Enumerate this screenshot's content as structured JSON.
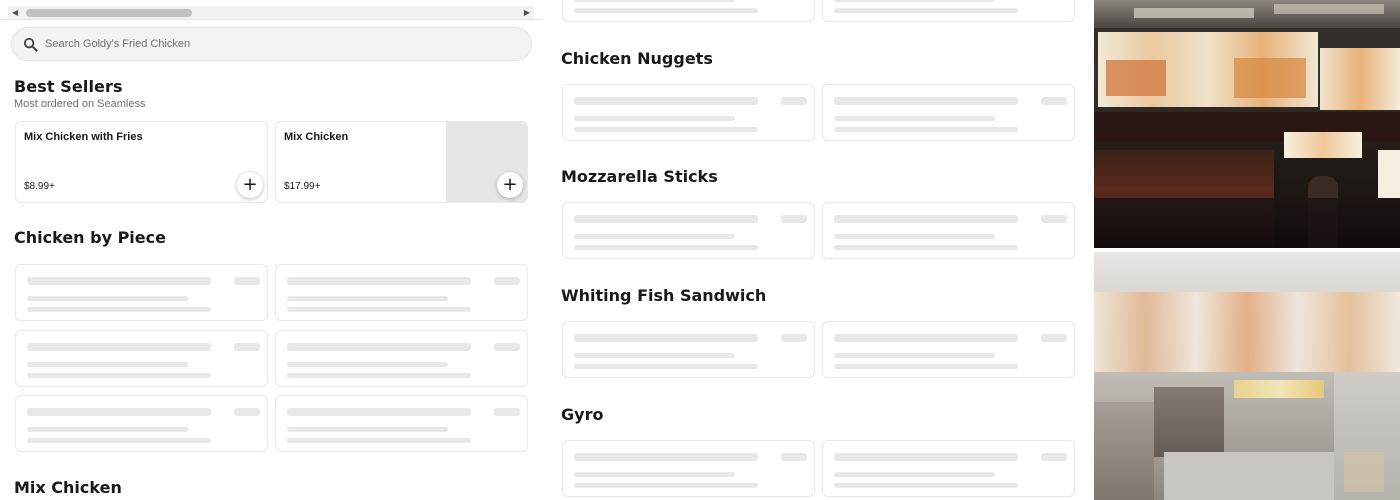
{
  "search": {
    "placeholder": "Search Goldy's Fried Chicken"
  },
  "best_sellers": {
    "title": "Best Sellers",
    "subtitle": "Most ordered on Seamless",
    "items": [
      {
        "name": "Mix Chicken with Fries",
        "price": "$8.99+"
      },
      {
        "name": "Mix Chicken",
        "price": "$17.99+"
      }
    ]
  },
  "sections": {
    "chicken_by_piece": "Chicken by Piece",
    "mix_chicken": "Mix Chicken",
    "chicken_nuggets": "Chicken Nuggets",
    "mozzarella_sticks": "Mozzarella Sticks",
    "whiting_fish_sandwich": "Whiting Fish Sandwich",
    "gyro": "Gyro"
  },
  "icons": {
    "search": "search-icon",
    "add": "plus-icon",
    "scroll_left": "scroll-left-arrow-icon",
    "scroll_right": "scroll-right-arrow-icon"
  },
  "colors": {
    "accent": "#191919",
    "skeleton": "#e8e8e8",
    "search_bg": "#f5f3f1"
  }
}
